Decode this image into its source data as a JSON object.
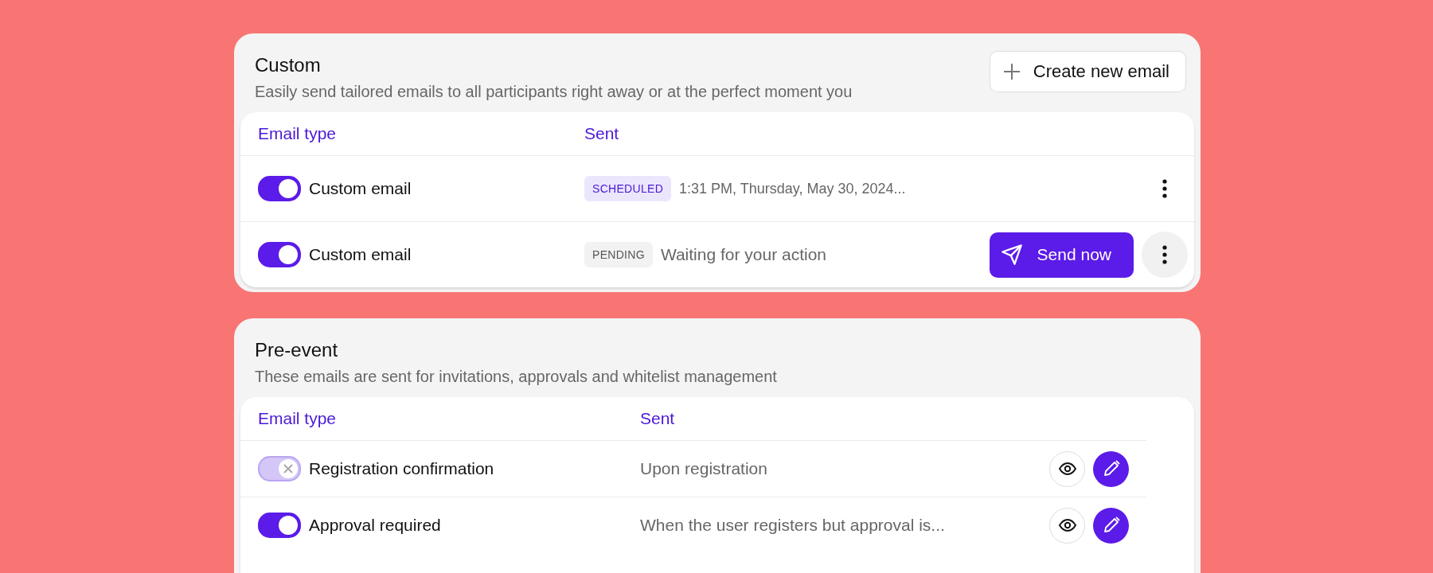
{
  "sections": [
    {
      "kind": "custom",
      "title": "Custom",
      "subtitle": "Easily send tailored emails to all participants right away or at the perfect moment you",
      "create_button": "Create new email",
      "columns": [
        "Email type",
        "Sent"
      ],
      "rows": [
        {
          "name": "Custom email",
          "on": true,
          "disabled": false,
          "status": {
            "kind": "scheduled",
            "label": "SCHEDULED"
          },
          "sent": "1:31 PM, Thursday, May 30, 2024...",
          "actions": [
            {
              "kind": "more",
              "highlighted": false
            }
          ]
        },
        {
          "name": "Custom email",
          "on": true,
          "disabled": false,
          "status": {
            "kind": "pending",
            "label": "PENDING"
          },
          "sent": "Waiting for your action",
          "actions": [
            {
              "kind": "send",
              "label": "Send now"
            },
            {
              "kind": "more",
              "highlighted": true
            }
          ]
        }
      ]
    },
    {
      "kind": "preset",
      "title": "Pre-event",
      "subtitle": "These emails are sent for invitations, approvals and whitelist management",
      "columns": [
        "Email type",
        "Sent"
      ],
      "rows": [
        {
          "name": "Registration confirmation",
          "on": true,
          "disabled": true,
          "sent": "Upon registration",
          "actions": [
            {
              "kind": "preview"
            },
            {
              "kind": "edit"
            }
          ]
        },
        {
          "name": "Approval required",
          "on": true,
          "disabled": false,
          "sent": "When the user registers but approval is...",
          "actions": [
            {
              "kind": "preview"
            },
            {
              "kind": "edit"
            }
          ]
        }
      ]
    }
  ]
}
